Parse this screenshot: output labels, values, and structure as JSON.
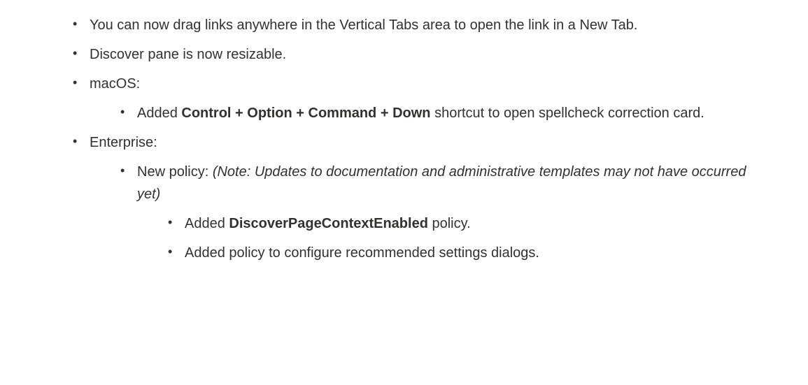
{
  "items": [
    {
      "text": "You can now drag links anywhere in the Vertical Tabs area to open the link in a New Tab."
    },
    {
      "text": "Discover pane is now resizable."
    },
    {
      "label": "macOS:",
      "children": [
        {
          "prefix": "Added ",
          "bold": "Control + Option + Command + Down",
          "suffix": " shortcut to open spellcheck correction card."
        }
      ]
    },
    {
      "label": "Enterprise:",
      "children": [
        {
          "prefix": "New policy: ",
          "italic": "(Note: Updates to documentation and administrative templates may not have occurred yet)",
          "children": [
            {
              "prefix": "Added ",
              "bold": "DiscoverPageContextEnabled",
              "suffix": " policy."
            },
            {
              "text": "Added policy to configure recommended settings dialogs."
            }
          ]
        }
      ]
    }
  ]
}
